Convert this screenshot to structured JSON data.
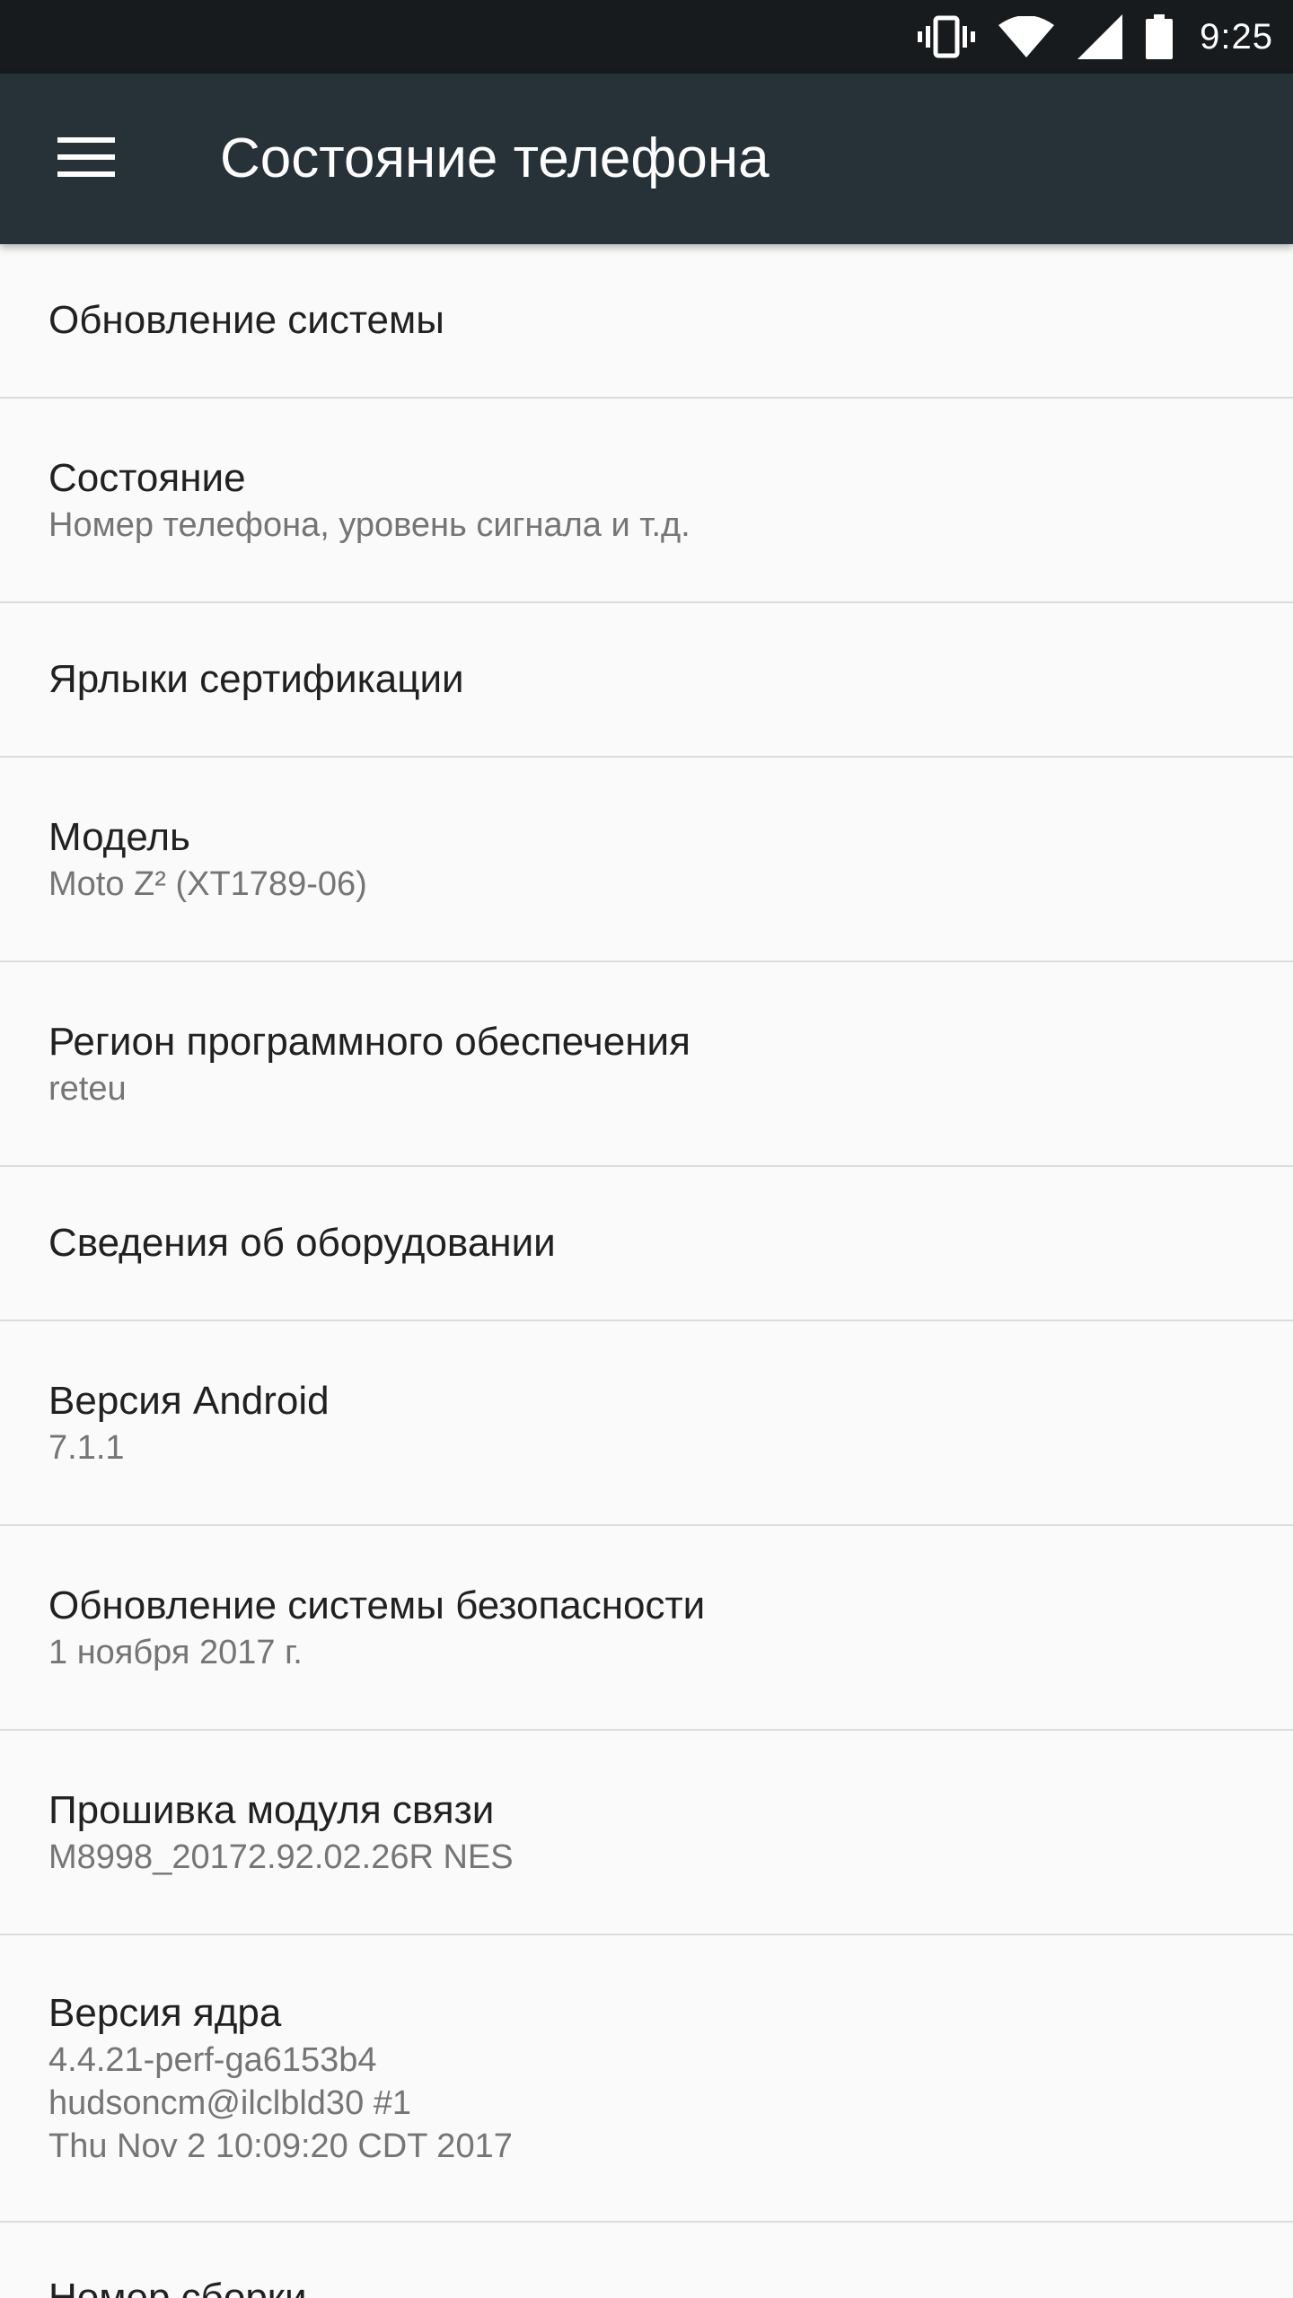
{
  "status_bar": {
    "time": "9:25",
    "icons": [
      "vibrate-icon",
      "wifi-icon",
      "cell-signal-icon",
      "battery-icon"
    ]
  },
  "app_bar": {
    "menu_icon": "hamburger-menu-icon",
    "title": "Состояние телефона",
    "background_color": "#263238"
  },
  "items": [
    {
      "title": "Обновление системы"
    },
    {
      "title": "Состояние",
      "summary": "Номер телефона, уровень сигнала и т.д."
    },
    {
      "title": "Ярлыки сертификации"
    },
    {
      "title": "Модель",
      "summary": "Moto Z² (XT1789-06)"
    },
    {
      "title": "Регион программного обеспечения",
      "summary": "reteu"
    },
    {
      "title": "Сведения об оборудовании"
    },
    {
      "title": "Версия Android",
      "summary": "7.1.1"
    },
    {
      "title": "Обновление системы безопасности",
      "summary": "1 ноября 2017 г."
    },
    {
      "title": "Прошивка модуля связи",
      "summary": "M8998_20172.92.02.26R NES"
    },
    {
      "title": "Версия ядра",
      "summary": "4.4.21-perf-ga6153b4\nhudsoncm@ilclbld30 #1\nThu Nov 2 10:09:20 CDT 2017"
    },
    {
      "title": "Номер сборки"
    }
  ]
}
